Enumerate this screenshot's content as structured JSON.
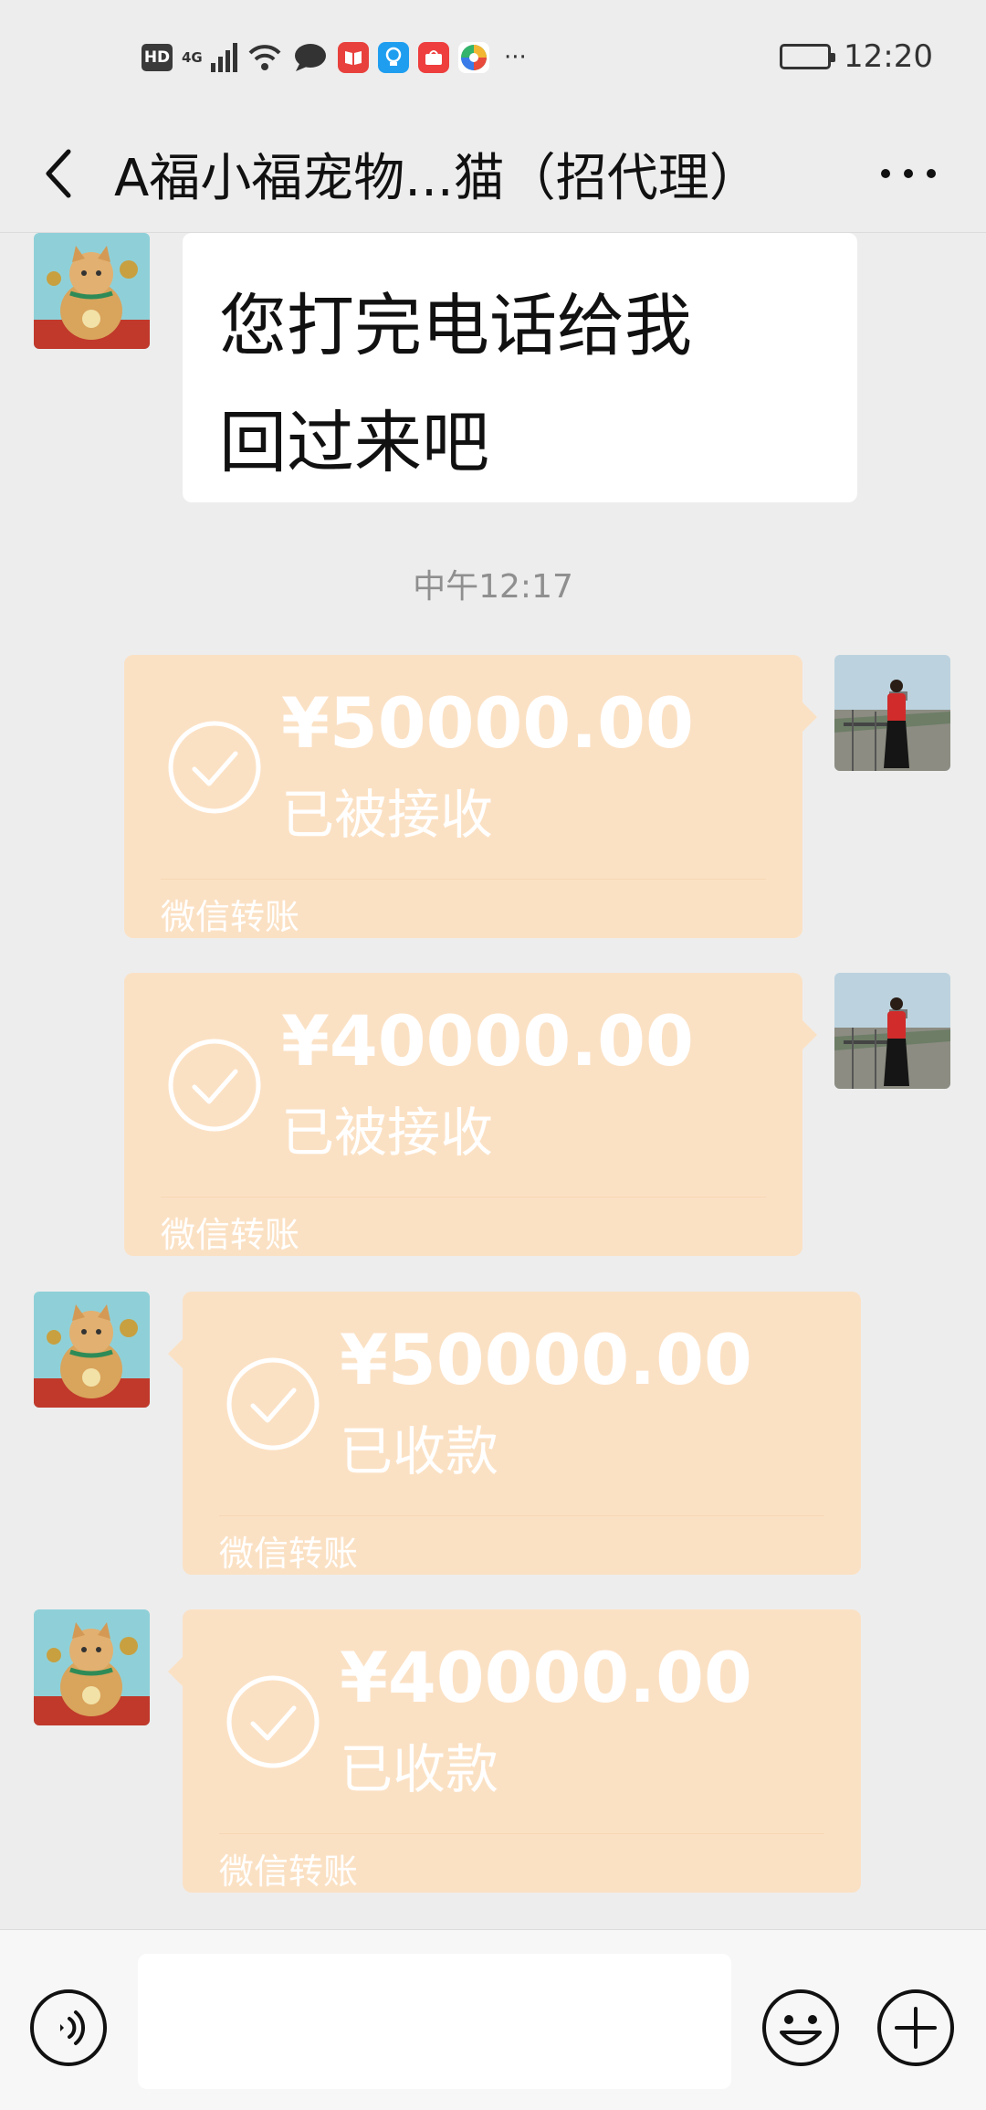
{
  "status_bar": {
    "hd": "HD",
    "network": "4G",
    "time": "12:20",
    "more": "···",
    "app_icons": [
      "book-app-icon",
      "lightbulb-app-icon",
      "shopping-app-icon",
      "browser-app-icon"
    ]
  },
  "header": {
    "title": "A福小福宠物...猫（招代理）",
    "back_icon": "chevron-left-icon",
    "more_icon": "more-dots-icon"
  },
  "messages": {
    "text_message": {
      "sender": "contact",
      "lines": [
        "您打完电话给我",
        "回过来吧"
      ]
    },
    "time_separator": "中午12:17",
    "transfers": [
      {
        "sender": "me",
        "amount": "¥50000.00",
        "status": "已被接收",
        "label": "微信转账"
      },
      {
        "sender": "me",
        "amount": "¥40000.00",
        "status": "已被接收",
        "label": "微信转账"
      },
      {
        "sender": "contact",
        "amount": "¥50000.00",
        "status": "已收款",
        "label": "微信转账"
      },
      {
        "sender": "contact",
        "amount": "¥40000.00",
        "status": "已收款",
        "label": "微信转账"
      }
    ]
  },
  "input_bar": {
    "value": "",
    "placeholder": "",
    "icons": [
      "voice-icon",
      "emoji-icon",
      "plus-icon"
    ]
  },
  "colors": {
    "background": "#ededed",
    "transfer_card": "#fbe1c4",
    "bubble": "#ffffff"
  }
}
